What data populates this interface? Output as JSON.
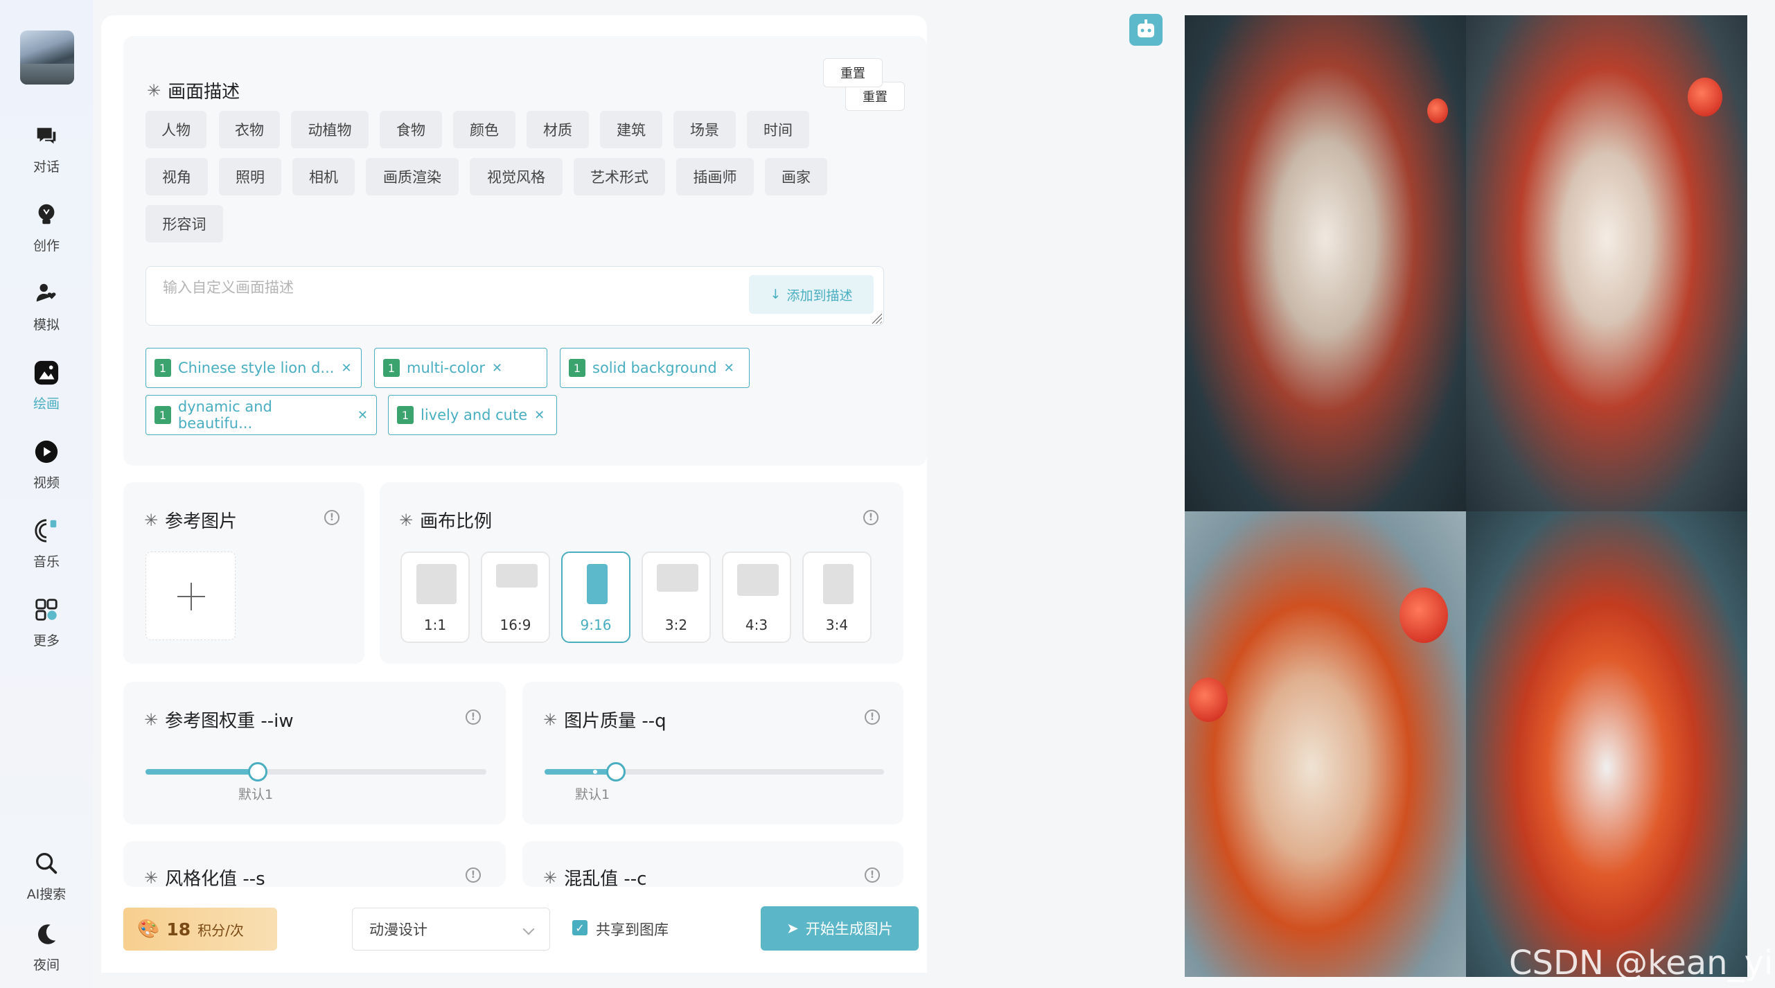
{
  "nav": {
    "items": [
      {
        "label": "对话",
        "icon": "chat-icon"
      },
      {
        "label": "创作",
        "icon": "bulb-icon"
      },
      {
        "label": "模拟",
        "icon": "persona-icon"
      },
      {
        "label": "绘画",
        "icon": "paint-icon"
      },
      {
        "label": "视频",
        "icon": "video-icon"
      },
      {
        "label": "音乐",
        "icon": "music-icon"
      },
      {
        "label": "更多",
        "icon": "grid-icon"
      }
    ],
    "bottom": [
      {
        "label": "AI搜索",
        "icon": "search-icon"
      },
      {
        "label": "夜间",
        "icon": "moon-icon"
      }
    ]
  },
  "description": {
    "title": "画面描述",
    "reset_label": "重置",
    "chips_row1": [
      "人物",
      "衣物",
      "动植物",
      "食物",
      "颜色",
      "材质",
      "建筑",
      "场景",
      "时间"
    ],
    "chips_row2": [
      "视角",
      "照明",
      "相机",
      "画质渲染",
      "视觉风格",
      "艺术形式",
      "插画师",
      "画家"
    ],
    "chips_row3": [
      "形容词"
    ],
    "input_placeholder": "输入自定义画面描述",
    "add_button": "添加到描述",
    "tags": [
      {
        "num": "1",
        "text": "Chinese style lion d..."
      },
      {
        "num": "1",
        "text": "multi-color"
      },
      {
        "num": "1",
        "text": "solid background"
      },
      {
        "num": "1",
        "text": "dynamic and beautifu..."
      },
      {
        "num": "1",
        "text": "lively and cute"
      }
    ]
  },
  "reference": {
    "title": "参考图片"
  },
  "ratio": {
    "title": "画布比例",
    "options": [
      "1:1",
      "16:9",
      "9:16",
      "3:2",
      "4:3",
      "3:4"
    ],
    "selected": "9:16"
  },
  "weight": {
    "title": "参考图权重 --iw",
    "caption": "默认1",
    "value": 0.33
  },
  "quality": {
    "title": "图片质量 --q",
    "caption": "默认1",
    "value": 0.21
  },
  "stylize": {
    "title": "风格化值 --s"
  },
  "chaos": {
    "title": "混乱值 --c"
  },
  "bottom": {
    "cost_num": "18",
    "cost_unit": "积分/次",
    "style_value": "动漫设计",
    "share_label": "共享到图库",
    "generate_label": "开始生成图片"
  },
  "watermark": "CSDN @kean_yin",
  "colors": {
    "accent": "#49aec0",
    "accent_fill": "#5cb9cc",
    "cost_bg": "#f7cf8f"
  }
}
